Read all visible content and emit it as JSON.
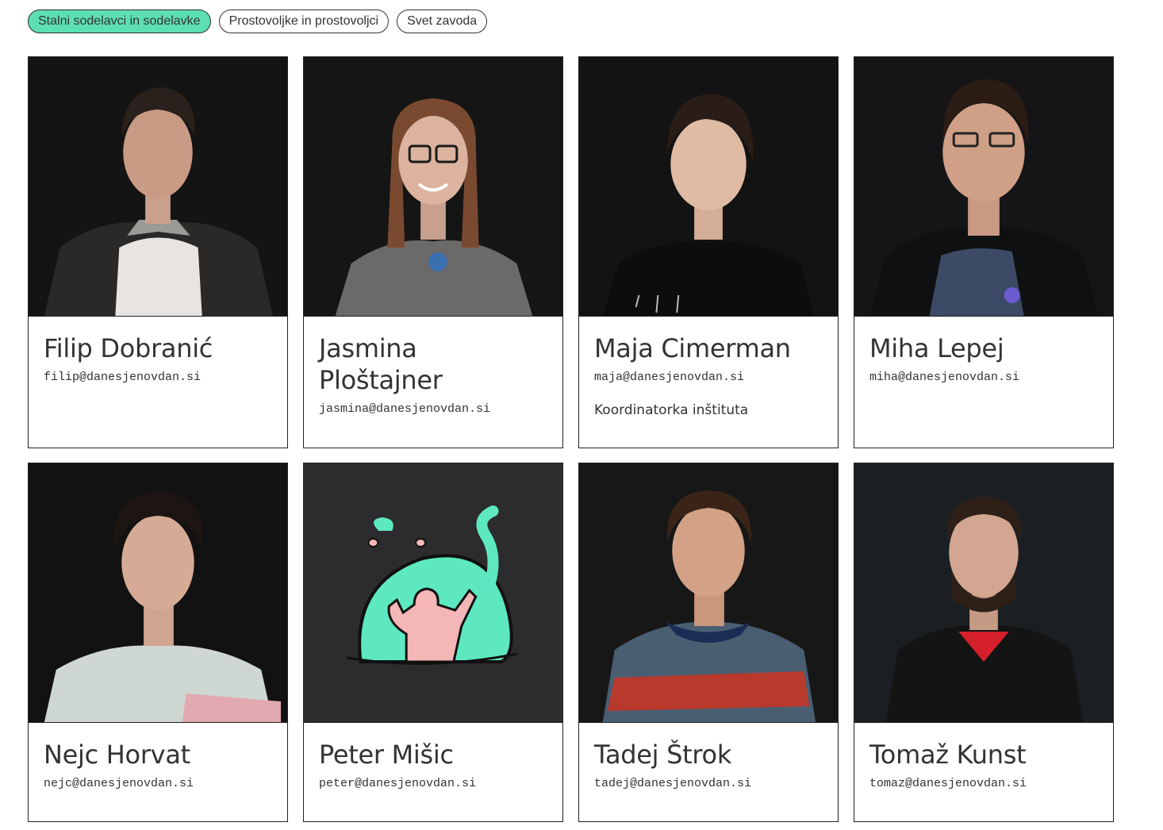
{
  "tabs": [
    {
      "label": "Stalni sodelavci in sodelavke",
      "active": true
    },
    {
      "label": "Prostovoljke in prostovoljci",
      "active": false
    },
    {
      "label": "Svet zavoda",
      "active": false
    }
  ],
  "colors": {
    "accent": "#5de0b1",
    "photo_background": "#1b1b1d",
    "illustration_background": "#2c2b2d",
    "border": "#222222"
  },
  "people": [
    {
      "name": "Filip Dobranić",
      "email": "filip@danesjenovdan.si",
      "role": "",
      "photo": "portrait-photo"
    },
    {
      "name": "Jasmina Ploštajner",
      "email": "jasmina@danesjenovdan.si",
      "role": "",
      "photo": "portrait-photo"
    },
    {
      "name": "Maja Cimerman",
      "email": "maja@danesjenovdan.si",
      "role": "Koordinatorka inštituta",
      "photo": "portrait-photo"
    },
    {
      "name": "Miha Lepej",
      "email": "miha@danesjenovdan.si",
      "role": "",
      "photo": "portrait-photo"
    },
    {
      "name": "Nejc Horvat",
      "email": "nejc@danesjenovdan.si",
      "role": "",
      "photo": "portrait-photo"
    },
    {
      "name": "Peter Mišic",
      "email": "peter@danesjenovdan.si",
      "role": "",
      "photo": "blob-illustration"
    },
    {
      "name": "Tadej Štrok",
      "email": "tadej@danesjenovdan.si",
      "role": "",
      "photo": "portrait-photo"
    },
    {
      "name": "Tomaž Kunst",
      "email": "tomaz@danesjenovdan.si",
      "role": "",
      "photo": "portrait-photo"
    }
  ]
}
